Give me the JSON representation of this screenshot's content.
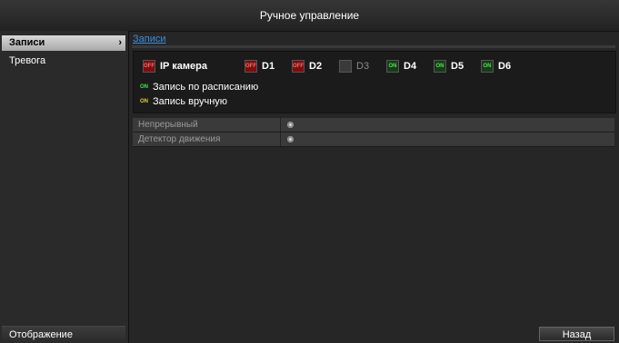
{
  "title": "Ручное управление",
  "sidebar": {
    "items": [
      {
        "label": "Записи",
        "active": true,
        "arrow": "›"
      },
      {
        "label": "Тревога",
        "active": false
      }
    ],
    "bottom": "Отображение"
  },
  "breadcrumb": "Записи",
  "channels": [
    {
      "label": "IP камера",
      "state": "red",
      "badge": "OFF"
    },
    {
      "label": "D1",
      "state": "red",
      "badge": "OFF"
    },
    {
      "label": "D2",
      "state": "red",
      "badge": "OFF"
    },
    {
      "label": "D3",
      "state": "gray",
      "badge": ""
    },
    {
      "label": "D4",
      "state": "green",
      "badge": "ON"
    },
    {
      "label": "D5",
      "state": "green",
      "badge": "ON"
    },
    {
      "label": "D6",
      "state": "green",
      "badge": "ON"
    }
  ],
  "legend": [
    {
      "badge": "ON",
      "color": "green",
      "text": "Запись по расписанию"
    },
    {
      "badge": "ON",
      "color": "yellow",
      "text": "Запись вручную"
    }
  ],
  "modes": [
    {
      "label": "Непрерывный"
    },
    {
      "label": "Детектор движения"
    }
  ],
  "back_button": "Назад"
}
